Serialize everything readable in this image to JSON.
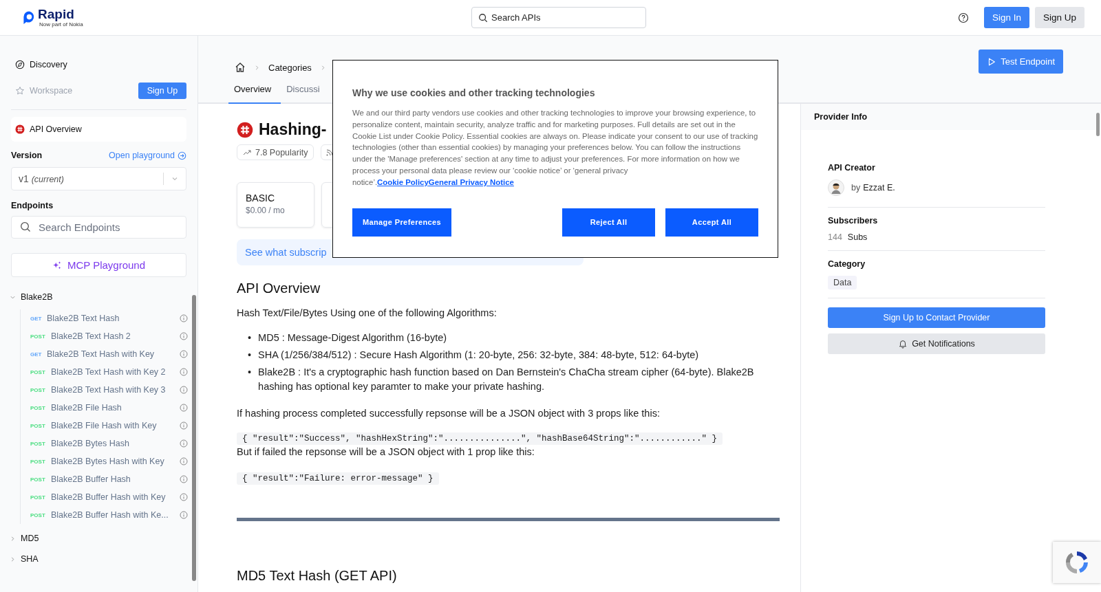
{
  "header": {
    "logo": "Rapid",
    "logo_tagline": "Now part of Nokia",
    "search": {
      "placeholder": "Search APIs"
    },
    "buttons": [
      {
        "label": "Sign In",
        "kind": "primary"
      },
      {
        "label": "Sign Up",
        "kind": "secondary"
      }
    ]
  },
  "sidebar": {
    "nav": [
      {
        "label": "Discovery",
        "disabled": false
      },
      {
        "label": "Workspace",
        "disabled": true
      }
    ],
    "workspace_button": "Sign Up",
    "api_overview": "API Overview",
    "version": {
      "label": "Version",
      "link": "Open playground",
      "value": "v1",
      "note": "(current)"
    },
    "endpoints": {
      "label": "Endpoints",
      "search_placeholder": "Search Endpoints",
      "mcp_button": "MCP Playground",
      "groups": [
        {
          "label": "Blake2B",
          "expanded": true,
          "children": [
            {
              "method": "GET",
              "kind": "get",
              "name": "Blake2B Text Hash"
            },
            {
              "method": "POST",
              "kind": "post",
              "name": "Blake2B Text Hash 2"
            },
            {
              "method": "GET",
              "kind": "get",
              "name": "Blake2B Text Hash with Key"
            },
            {
              "method": "POST",
              "kind": "post",
              "name": "Blake2B Text Hash with Key 2"
            },
            {
              "method": "POST",
              "kind": "post",
              "name": "Blake2B Text Hash with Key 3"
            },
            {
              "method": "POST",
              "kind": "post",
              "name": "Blake2B File Hash"
            },
            {
              "method": "POST",
              "kind": "post",
              "name": "Blake2B File Hash with Key"
            },
            {
              "method": "POST",
              "kind": "post",
              "name": "Blake2B Bytes Hash"
            },
            {
              "method": "POST",
              "kind": "post",
              "name": "Blake2B Bytes Hash with Key"
            },
            {
              "method": "POST",
              "kind": "post",
              "name": "Blake2B Buffer Hash"
            },
            {
              "method": "POST",
              "kind": "post",
              "name": "Blake2B Buffer Hash with Key"
            },
            {
              "method": "POST",
              "kind": "post",
              "name": "Blake2B Buffer Hash with Ke..."
            }
          ]
        },
        {
          "label": "MD5",
          "expanded": false
        },
        {
          "label": "SHA",
          "expanded": false
        }
      ]
    }
  },
  "main": {
    "breadcrumbs": [
      "Categories"
    ],
    "tabs": [
      {
        "label": "Overview",
        "selected": true
      },
      {
        "label": "Discussi",
        "selected": false
      }
    ],
    "test_button": "Test Endpoint",
    "title": "Hashing-",
    "popularity": "7.8 Popularity",
    "plans": [
      {
        "name": "BASIC",
        "price": "$0.00 / mo"
      }
    ],
    "subscribe_banner": "See what subscrip",
    "overview": {
      "heading": "API Overview",
      "intro": "Hash Text/File/Bytes Using one of the following Algorithms:",
      "bullets": [
        {
          "marker": "•",
          "text": "MD5 : Message-Digest Algorithm (16-byte)"
        },
        {
          "marker": "•",
          "text": "SHA (1/256/384/512) : Secure Hash Algorithm (1: 20-byte, 256: 32-byte, 384: 48-byte, 512: 64-byte)"
        },
        {
          "marker": "•",
          "text": "Blake2B : It's a cryptographic hash function based on Dan Bernstein's ChaCha stream cipher (64-byte). Blake2B hashing has optional key paramter to make your private hashing."
        }
      ],
      "success_text": "If hashing process completed successfully repsonse will be a JSON object with 3 props like this:",
      "success_code": "{ \"result\":\"Success\", \"hashHexString\":\"...............\", \"hashBase64String\":\"............\" }",
      "failure_text": "But if failed the repsonse will be a JSON object with 1 prop like this:",
      "failure_code": "{ \"result\":\"Failure: error-message\" }"
    },
    "next_heading": "MD5 Text Hash (GET API)"
  },
  "provider": {
    "title": "Provider Info",
    "creator_label": "API Creator",
    "creator_prefix": "by",
    "creator_name": "Ezzat E.",
    "subs_label": "Subscribers",
    "subs_count": "144",
    "subs_unit": "Subs",
    "category_label": "Category",
    "category": "Data",
    "contact_button": "Sign Up to Contact Provider",
    "notify_button": "Get Notifications"
  },
  "cookie_dialog": {
    "title": "Why we use cookies and other tracking technologies",
    "body": "We and our third party vendors use cookies and other tracking technologies to improve your browsing experience, to personalize content, maintain security, analyze traffic and for marketing purposes. Full details are set out in the Cookie List under Cookie Policy. Essential cookies are always on. Please indicate your consent to our use of tracking technologies (other than essential cookies) by managing your preferences below. You can follow the instructions under the 'Manage preferences' section at any time to adjust your preferences. For more information on how we process your personal data please review our ‘cookie notice’ or ‘general privacy notice’.",
    "links": [
      "Cookie Policy",
      "General Privacy Notice"
    ],
    "buttons": [
      "Manage Preferences",
      "Reject All",
      "Accept All"
    ]
  }
}
